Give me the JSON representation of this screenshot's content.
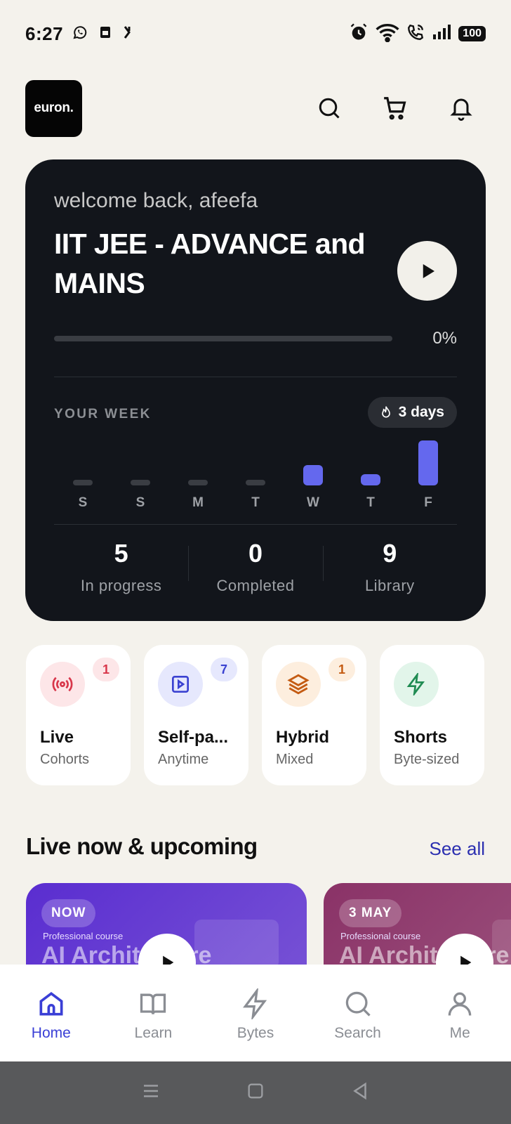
{
  "status_bar": {
    "time": "6:27",
    "battery": "100"
  },
  "header": {
    "logo_text": "euron."
  },
  "hero": {
    "welcome": "welcome back, afeefa",
    "course_title": "IIT JEE - ADVANCE and MAINS",
    "progress_percent": "0%",
    "progress_value": 0,
    "week_label": "YOUR WEEK",
    "streak": "3 days",
    "week": [
      {
        "day": "S",
        "level": 0
      },
      {
        "day": "S",
        "level": 0
      },
      {
        "day": "M",
        "level": 0
      },
      {
        "day": "T",
        "level": 0
      },
      {
        "day": "W",
        "level": 0.45
      },
      {
        "day": "T",
        "level": 0.2
      },
      {
        "day": "F",
        "level": 1
      }
    ],
    "stats": [
      {
        "value": "5",
        "label": "In progress"
      },
      {
        "value": "0",
        "label": "Completed"
      },
      {
        "value": "9",
        "label": "Library"
      }
    ],
    "colors": {
      "accent": "#6468ee",
      "inactive": "#3a3d43"
    }
  },
  "categories": [
    {
      "title": "Live",
      "subtitle": "Cohorts",
      "badge": "1",
      "icon": "broadcast-icon",
      "bg": "#fde6e8",
      "fg": "#d8364a",
      "badge_bg": "#fde6e8",
      "badge_fg": "#d8364a"
    },
    {
      "title": "Self-pa...",
      "subtitle": "Anytime",
      "badge": "7",
      "icon": "play-square-icon",
      "bg": "#e6e8fd",
      "fg": "#3b42d1",
      "badge_bg": "#e6e8fd",
      "badge_fg": "#3b42d1"
    },
    {
      "title": "Hybrid",
      "subtitle": "Mixed",
      "badge": "1",
      "icon": "layers-icon",
      "bg": "#fdeede",
      "fg": "#c45b12",
      "badge_bg": "#fdeede",
      "badge_fg": "#c45b12"
    },
    {
      "title": "Shorts",
      "subtitle": "Byte-sized",
      "badge": "",
      "icon": "bolt-icon",
      "bg": "#e2f5ea",
      "fg": "#1f8b52"
    }
  ],
  "section": {
    "title": "Live now & upcoming",
    "see_all": "See all"
  },
  "live_cards": [
    {
      "badge": "NOW",
      "type": "Professional course",
      "title": "AI Architecture",
      "bg": "#5a2dd0"
    },
    {
      "badge": "3 MAY",
      "type": "Professional course",
      "title": "AI Architecture",
      "bg": "#8a3267"
    }
  ],
  "bottom_nav": [
    {
      "label": "Home",
      "icon": "home-icon",
      "active": true
    },
    {
      "label": "Learn",
      "icon": "book-icon",
      "active": false
    },
    {
      "label": "Bytes",
      "icon": "bolt-icon",
      "active": false
    },
    {
      "label": "Search",
      "icon": "search-icon",
      "active": false
    },
    {
      "label": "Me",
      "icon": "person-icon",
      "active": false
    }
  ]
}
